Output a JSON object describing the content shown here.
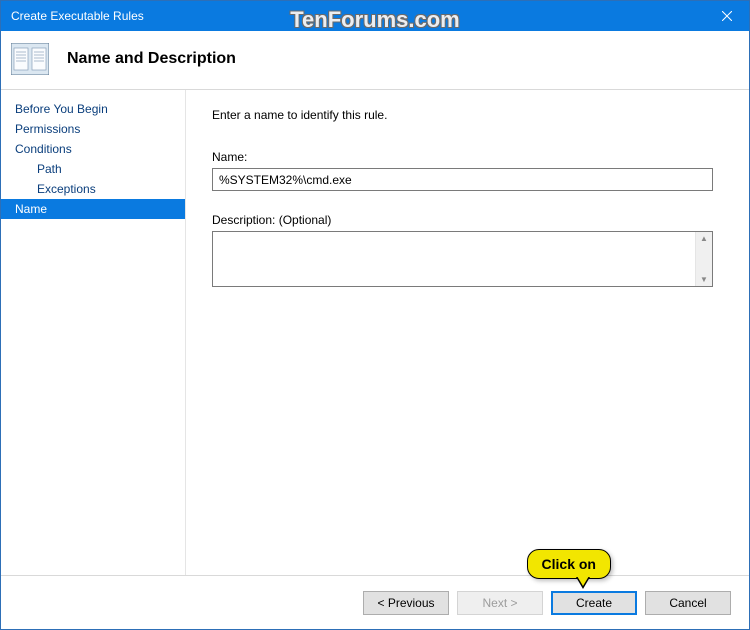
{
  "window": {
    "title": "Create Executable Rules"
  },
  "watermark": "TenForums.com",
  "header": {
    "heading": "Name and Description"
  },
  "sidebar": {
    "items": [
      {
        "label": "Before You Begin",
        "indent": false,
        "selected": false
      },
      {
        "label": "Permissions",
        "indent": false,
        "selected": false
      },
      {
        "label": "Conditions",
        "indent": false,
        "selected": false
      },
      {
        "label": "Path",
        "indent": true,
        "selected": false
      },
      {
        "label": "Exceptions",
        "indent": true,
        "selected": false
      },
      {
        "label": "Name",
        "indent": false,
        "selected": true
      }
    ]
  },
  "content": {
    "instruction": "Enter a name to identify this rule.",
    "name_label": "Name:",
    "name_value": "%SYSTEM32%\\cmd.exe",
    "description_label": "Description: (Optional)",
    "description_value": ""
  },
  "footer": {
    "previous": "< Previous",
    "next": "Next >",
    "create": "Create",
    "cancel": "Cancel"
  },
  "callout": {
    "text": "Click on"
  }
}
